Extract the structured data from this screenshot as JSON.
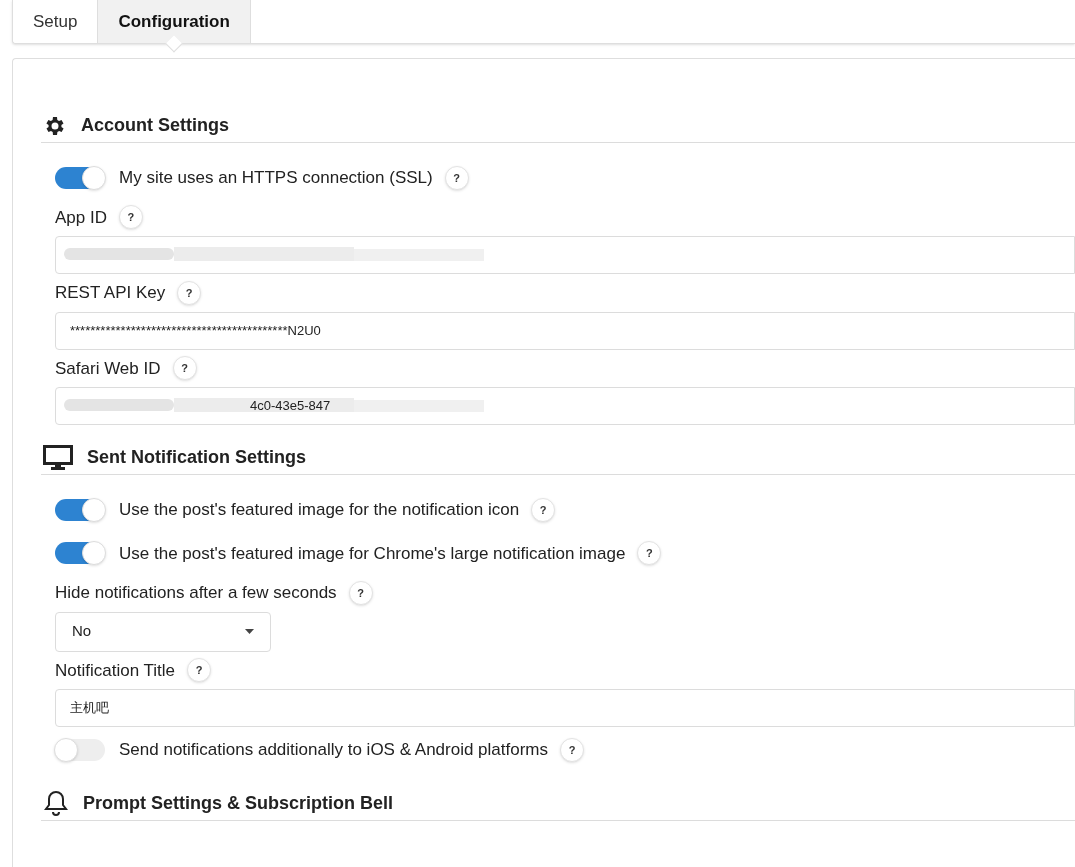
{
  "tabs": [
    {
      "label": "Setup",
      "selected": false
    },
    {
      "label": "Configuration",
      "selected": true
    }
  ],
  "sections": [
    {
      "title": "Account Settings",
      "items": [
        {
          "kind": "toggle",
          "label": "My site uses an HTTPS connection (SSL)",
          "on": true,
          "help": "?"
        },
        {
          "kind": "field",
          "label": "App ID",
          "help": "?",
          "redacted": true
        },
        {
          "kind": "field",
          "label": "REST API Key",
          "help": "?",
          "value": "*******************************************N2U0"
        },
        {
          "kind": "field",
          "label": "Safari Web ID",
          "help": "?",
          "value": "4c0-43e5-847",
          "redacted": true
        }
      ]
    },
    {
      "title": "Sent Notification Settings",
      "items": [
        {
          "kind": "toggle",
          "label": "Use the post's featured image for the notification icon",
          "on": true,
          "help": "?"
        },
        {
          "kind": "toggle",
          "label": "Use the post's featured image for Chrome's large notification image",
          "on": true,
          "help": "?"
        },
        {
          "kind": "select",
          "label": "Hide notifications after a few seconds",
          "help": "?",
          "value": "No"
        },
        {
          "kind": "field",
          "label": "Notification Title",
          "help": "?",
          "value": "主机吧"
        },
        {
          "kind": "toggle",
          "label": "Send notifications additionally to iOS & Android platforms",
          "on": false,
          "help": "?"
        }
      ]
    },
    {
      "title": "Prompt Settings & Subscription Bell"
    }
  ]
}
